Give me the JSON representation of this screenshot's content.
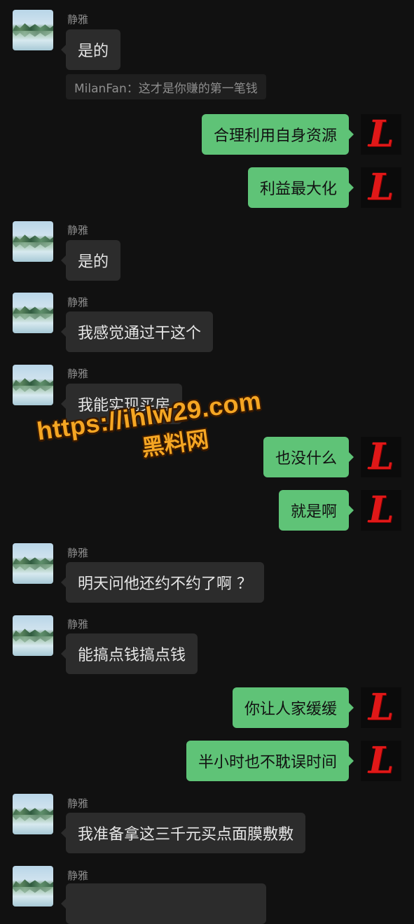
{
  "chat": {
    "contact_name": "静雅",
    "messages": [
      {
        "side": "in",
        "text": "是的"
      },
      {
        "quote": "MilanFan：这才是你赚的第一笔钱"
      },
      {
        "side": "out",
        "text": "合理利用自身资源"
      },
      {
        "side": "out",
        "text": "利益最大化"
      },
      {
        "side": "in",
        "text": "是的"
      },
      {
        "side": "in",
        "text": "我感觉通过干这个"
      },
      {
        "side": "in",
        "text": "我能实现买房"
      },
      {
        "side": "out",
        "text": "也没什么"
      },
      {
        "side": "out",
        "text": "就是啊"
      },
      {
        "side": "in",
        "text": "明天问他还约不约了啊 ？"
      },
      {
        "side": "in",
        "text": "能搞点钱搞点钱"
      },
      {
        "side": "out",
        "text": "你让人家缓缓"
      },
      {
        "side": "out",
        "text": "半小时也不耽误时间"
      },
      {
        "side": "in",
        "text": "我准备拿这三千元买点面膜敷敷"
      },
      {
        "side": "in",
        "text": ""
      }
    ]
  },
  "self_avatar_letter": "L",
  "watermark": {
    "url": "https://ihlw29.com",
    "site": "黑料网"
  },
  "colors": {
    "background": "#111111",
    "incoming_bubble": "#2c2c2c",
    "outgoing_bubble": "#5fc377",
    "watermark": "#f5a623"
  }
}
